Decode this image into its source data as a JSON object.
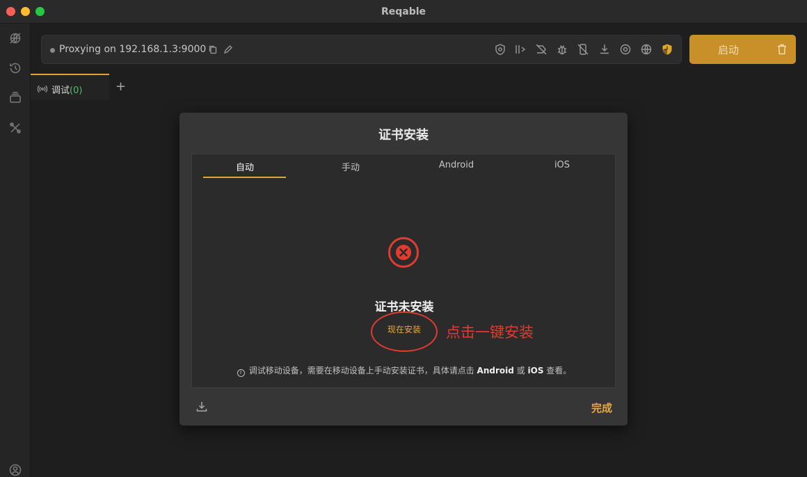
{
  "window": {
    "title": "Reqable"
  },
  "sidebar": {
    "items": [
      {
        "icon": "globe-off-icon"
      },
      {
        "icon": "history-icon"
      },
      {
        "icon": "collection-icon"
      },
      {
        "icon": "tools-icon"
      },
      {
        "icon": "account-icon"
      }
    ]
  },
  "proxy": {
    "status_text": "Proxying on 192.168.1.3:9000",
    "toolbar_icons": [
      "copy-icon",
      "edit-icon",
      "ssl-shield-icon",
      "bandwidth-icon",
      "breakpoint-off-icon",
      "script-bug-icon",
      "mobile-off-icon",
      "download-icon",
      "record-icon",
      "globe-proxy-icon",
      "certificate-shield-icon"
    ]
  },
  "start_button": {
    "label": "启动"
  },
  "tabs": {
    "debug_label": "调试",
    "debug_count": "(0)",
    "add_label": "+"
  },
  "dialog": {
    "title": "证书安装",
    "tabs": [
      {
        "label": "自动",
        "active": true
      },
      {
        "label": "手动",
        "active": false
      },
      {
        "label": "Android",
        "active": false
      },
      {
        "label": "iOS",
        "active": false
      }
    ],
    "status": "证书未安装",
    "install_label": "现在安装",
    "annotation": "点击一键安装",
    "hint": {
      "prefix": "调试移动设备，需要在移动设备上手动安装证书，具体请点击",
      "android": "Android",
      "or": "或",
      "ios": "iOS",
      "suffix": "查看。"
    },
    "done_label": "完成"
  },
  "colors": {
    "accent": "#e3a43b",
    "start_button": "#c98f28",
    "error": "#e23b2f",
    "count_green": "#4fbf6b"
  }
}
